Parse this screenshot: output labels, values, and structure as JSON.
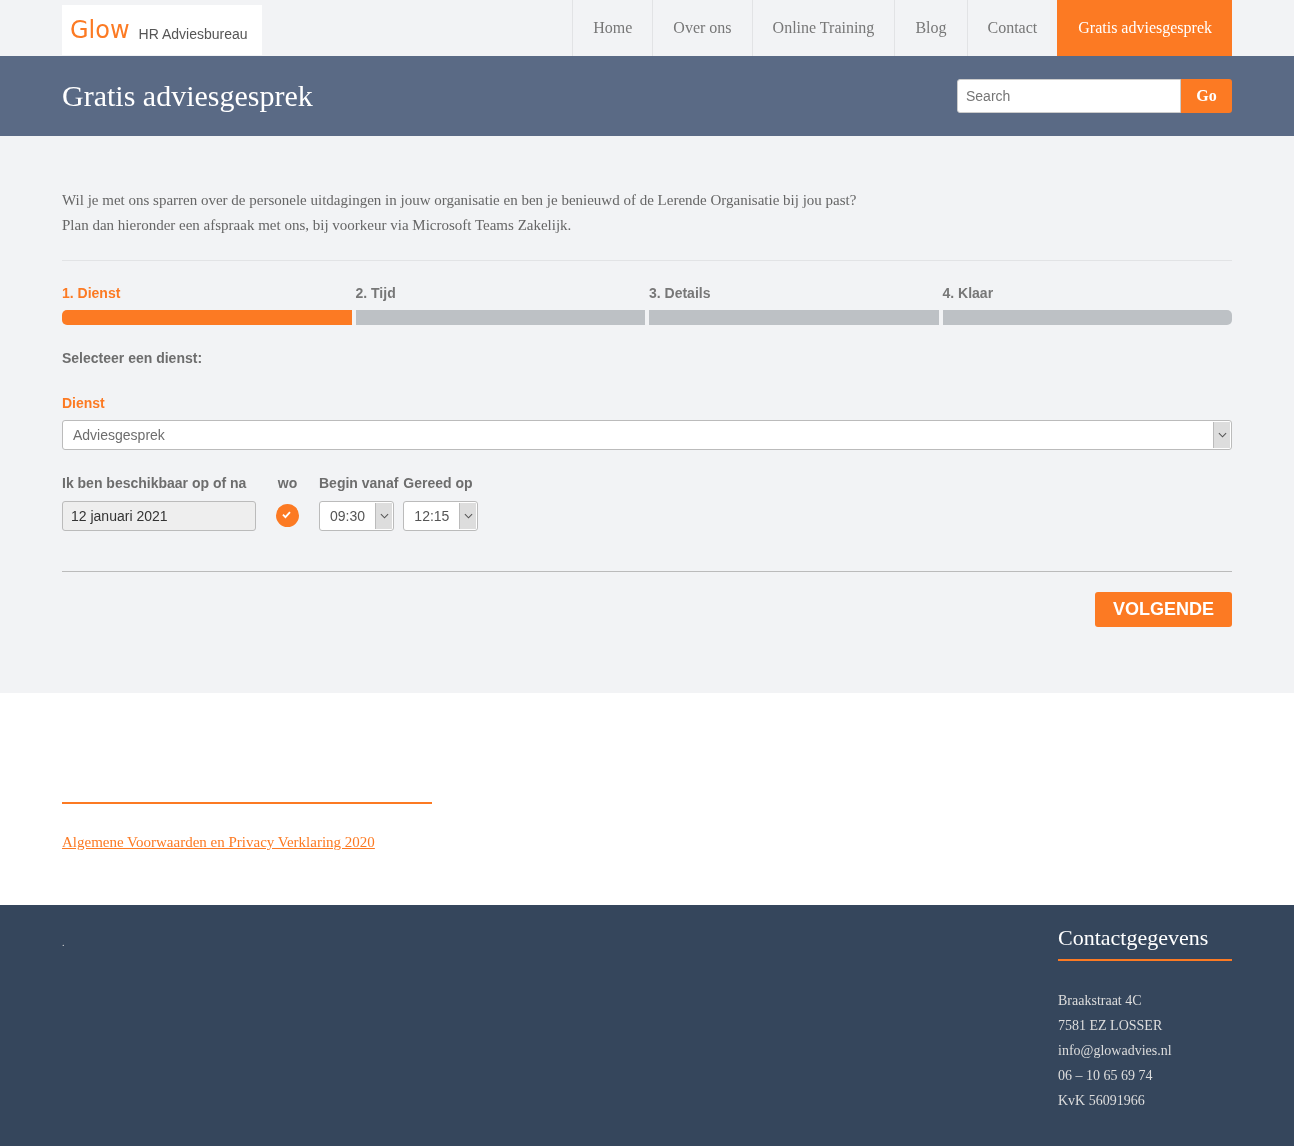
{
  "header": {
    "logo": {
      "brand": "Glow",
      "tagline": "HR Adviesbureau"
    },
    "nav": [
      {
        "label": "Home",
        "selected": false
      },
      {
        "label": "Over ons",
        "selected": false
      },
      {
        "label": "Online Training",
        "selected": false
      },
      {
        "label": "Blog",
        "selected": false
      },
      {
        "label": "Contact",
        "selected": false
      },
      {
        "label": "Gratis adviesgesprek",
        "selected": true
      }
    ]
  },
  "banner": {
    "title": "Gratis adviesgesprek",
    "search": {
      "placeholder": "Search",
      "button": "Go"
    }
  },
  "intro": [
    "Wil je met ons sparren over de personele uitdagingen in jouw organisatie en ben je benieuwd of de Lerende Organisatie bij jou past?",
    "Plan dan hieronder een afspraak met ons, bij voorkeur via Microsoft Teams Zakelijk."
  ],
  "steps": [
    {
      "label": "1. Dienst",
      "selected": true
    },
    {
      "label": "2. Tijd",
      "selected": false
    },
    {
      "label": "3. Details",
      "selected": false
    },
    {
      "label": "4. Klaar",
      "selected": false
    }
  ],
  "form": {
    "heading": "Selecteer een dienst:",
    "service_label": "Dienst",
    "service_value": "Adviesgesprek",
    "date_label": "Ik ben beschikbaar op of na",
    "date_value": "12 januari 2021",
    "day_label": "wo",
    "day_checked": true,
    "start_label": "Begin vanaf",
    "start_value": "09:30",
    "end_label": "Gereed op",
    "end_value": "12:15",
    "next_button": "VOLGENDE"
  },
  "terms_link": "Algemene Voorwaarden en Privacy Verklaring 2020",
  "footer": {
    "note": ".",
    "contact_title": "Contactgegevens",
    "contact_lines": [
      "Braakstraat 4C",
      "7581 EZ LOSSER",
      "info@glowadvies.nl",
      "06 – 10 65 69 74",
      "KvK 56091966"
    ]
  }
}
